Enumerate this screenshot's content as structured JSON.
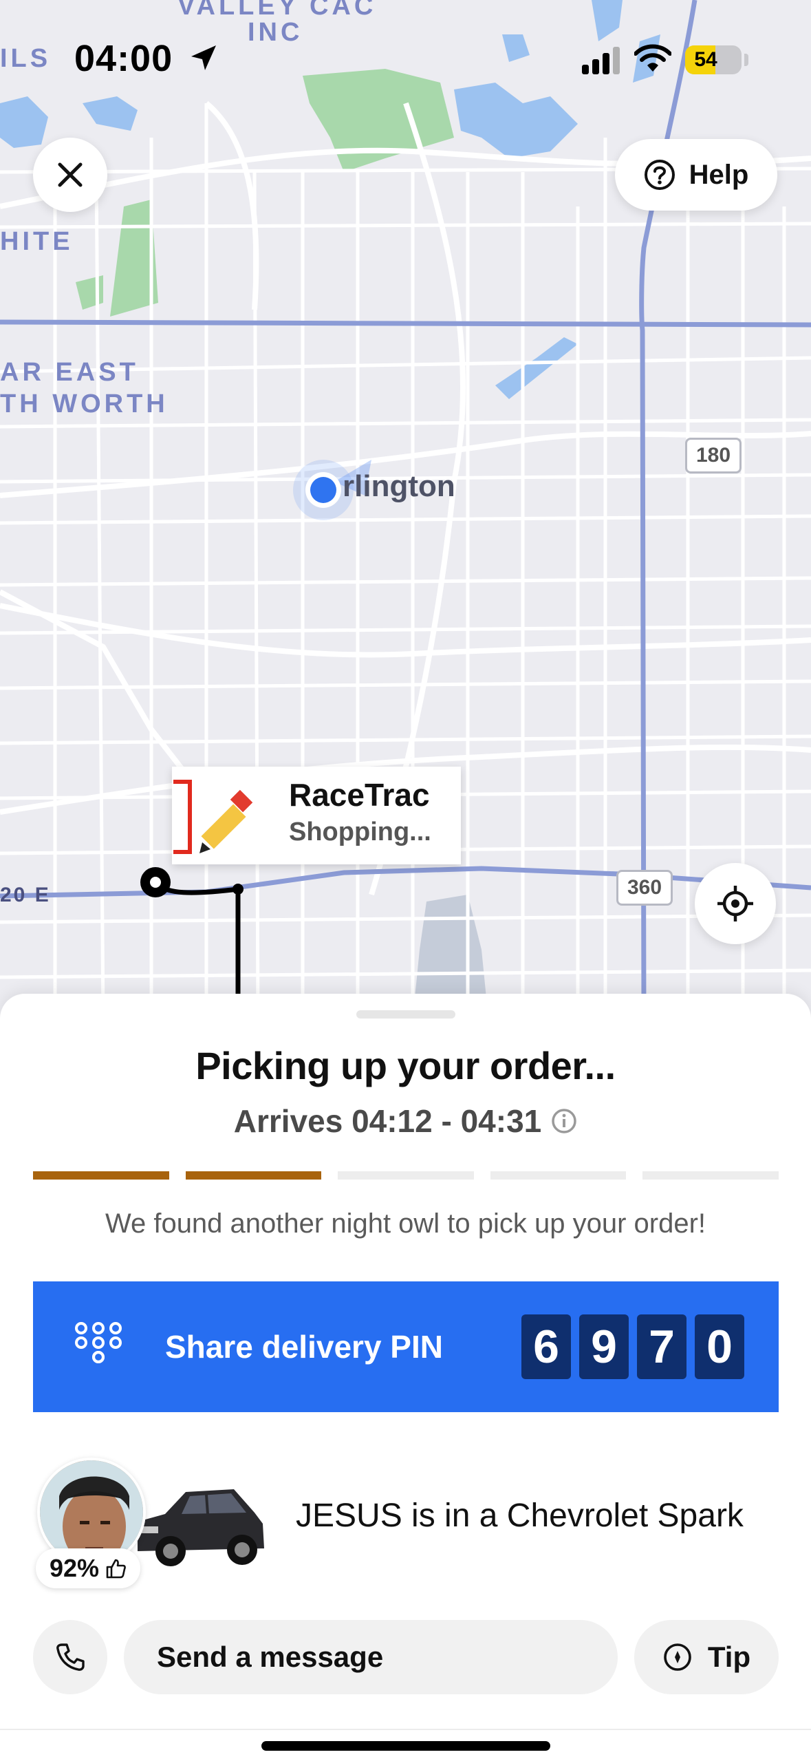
{
  "status_bar": {
    "time": "04:00",
    "battery": "54",
    "battery_level": 0.54,
    "icons": [
      "location-arrow-icon",
      "cellular-signal-icon",
      "wifi-icon",
      "battery-icon"
    ]
  },
  "map": {
    "area_labels": [
      "VALLEY CAC",
      "INC",
      "ILS",
      "HITE",
      "AR EAST",
      "TH WORTH",
      "20 E"
    ],
    "city_label": "rlington",
    "highway_shields": [
      "180",
      "360"
    ],
    "colors": {
      "background": "#ececf1",
      "major_road": "#8b9bd6",
      "water": "#9cc2f0",
      "park": "#a8d8ab",
      "label": "#7b86c4"
    }
  },
  "controls": {
    "close_icon": "close-icon",
    "help_label": "Help",
    "help_icon": "question-circle-icon",
    "locate_icon": "locate-crosshair-icon"
  },
  "store_card": {
    "name": "RaceTrac",
    "status": "Shopping..."
  },
  "order": {
    "title": "Picking up your order...",
    "eta": "Arrives 04:12 - 04:31",
    "progress_total": 5,
    "progress_done": 2,
    "progress_color": "#a8630d",
    "message": "We found another night owl to pick up your order!"
  },
  "pin": {
    "label": "Share delivery PIN",
    "digits": [
      "6",
      "9",
      "7",
      "0"
    ],
    "banner_color": "#276ef1"
  },
  "driver": {
    "rating": "92%",
    "description": "JESUS is in a Chevrolet Spark"
  },
  "actions": {
    "message_label": "Send a message",
    "tip_label": "Tip"
  }
}
